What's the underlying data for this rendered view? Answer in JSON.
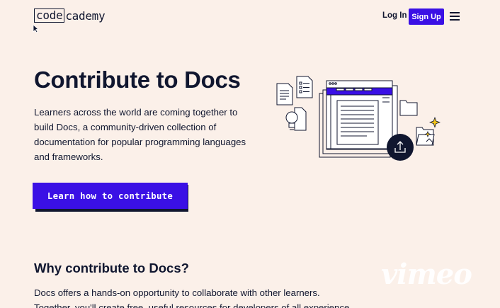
{
  "header": {
    "logo_boxed": "code",
    "logo_rest": "cademy",
    "login_label": "Log In",
    "signup_label": "Sign Up"
  },
  "hero": {
    "title": "Contribute to Docs",
    "description": "Learners across the world are coming together to build Docs, a community-driven collection of documentation for popular programming languages and frameworks.",
    "cta_label": "Learn how to contribute"
  },
  "why": {
    "heading": "Why contribute to Docs?",
    "text": "Docs offers a hands-on opportunity to collaborate with other learners. Together, you'll create free, useful resources for developers of all experience"
  },
  "watermark": "vimeo",
  "colors": {
    "background": "#fbf0e9",
    "primary": "#3a10e5",
    "ink": "#10162f",
    "sparkle": "#f5c518"
  },
  "icons": [
    "menu-icon",
    "upload-icon",
    "lightbulb-icon",
    "folder-icon",
    "document-icon",
    "sparkle-icon",
    "cursor-icon"
  ]
}
